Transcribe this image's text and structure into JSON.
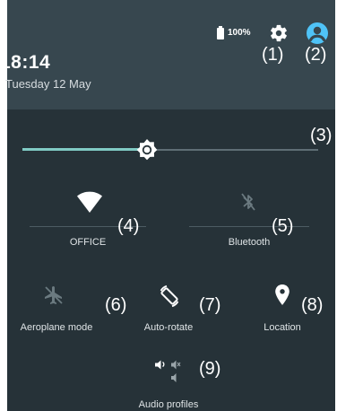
{
  "status": {
    "battery_percent": "100%",
    "time": "18:14",
    "date": "Tuesday 12 May"
  },
  "brightness": {
    "level": 0.42
  },
  "tiles": [
    {
      "label": "OFFICE",
      "icon": "wifi-icon",
      "state": "on"
    },
    {
      "label": "Bluetooth",
      "icon": "bluetooth-icon",
      "state": "off"
    },
    {
      "label": "Aeroplane mode",
      "icon": "airplane-icon",
      "state": "off"
    },
    {
      "label": "Auto-rotate",
      "icon": "auto-rotate-icon",
      "state": "on"
    },
    {
      "label": "Location",
      "icon": "location-pin-icon",
      "state": "on"
    },
    {
      "label": "Audio profiles",
      "icon": "audio-profiles-icon",
      "state": "on"
    }
  ],
  "callouts": [
    "(1)",
    "(2)",
    "(3)",
    "(4)",
    "(5)",
    "(6)",
    "(7)",
    "(8)",
    "(9)"
  ],
  "colors": {
    "panel": "#263238",
    "header": "#37474f",
    "accent": "#80cbc4",
    "avatar": "#4fc3f7",
    "icon_off": "#6b7a80"
  }
}
